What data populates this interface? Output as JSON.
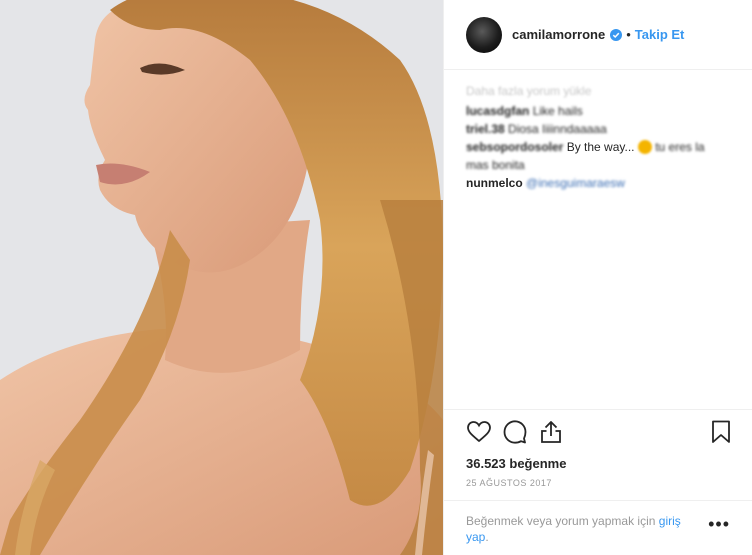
{
  "post": {
    "username": "camilamorrone",
    "separator": "•",
    "follow_label": "Takip Et"
  },
  "comments": {
    "load_more": "Daha fazla yorum yükle",
    "items": [
      {
        "author": "lucasdgfan",
        "text": "Like hails"
      },
      {
        "author": "triel.38",
        "text": "Diosa Iiiinndaaaaa"
      },
      {
        "author": "sebsopordosoler",
        "text": "By the way...",
        "text_after": "tu eres la mas bonita"
      },
      {
        "author": "nunmelco",
        "mention": "@inesguimaraesw"
      }
    ]
  },
  "actions": {
    "likes": "36.523 beğenme",
    "date": "25 AĞUSTOS 2017"
  },
  "login": {
    "prompt": "Beğenmek veya yorum yapmak için",
    "link": "giriş yap",
    "suffix": ".",
    "more": "•••"
  },
  "colors": {
    "accent": "#3897f0",
    "verified": "#3897f0"
  }
}
